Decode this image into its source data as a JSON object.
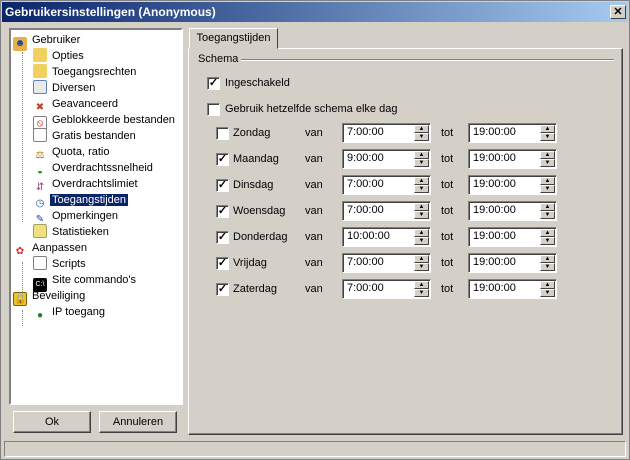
{
  "window": {
    "title": "Gebruikersinstellingen (Anonymous)"
  },
  "tree": {
    "items": [
      {
        "label": "Gebruiker",
        "icon": "user-icon",
        "selected": false
      },
      {
        "label": "Opties",
        "icon": "folder-options-icon",
        "selected": false
      },
      {
        "label": "Toegangsrechten",
        "icon": "folder-permissions-icon",
        "selected": false
      },
      {
        "label": "Diversen",
        "icon": "document-icon",
        "selected": false
      },
      {
        "label": "Geavanceerd",
        "icon": "tools-icon",
        "selected": false
      },
      {
        "label": "Geblokkeerde bestanden",
        "icon": "blocked-file-icon",
        "selected": false
      },
      {
        "label": "Gratis bestanden",
        "icon": "file-icon",
        "selected": false
      },
      {
        "label": "Quota, ratio",
        "icon": "quota-icon",
        "selected": false
      },
      {
        "label": "Overdrachtssnelheid",
        "icon": "gauge-icon",
        "selected": false
      },
      {
        "label": "Overdrachtslimiet",
        "icon": "limit-icon",
        "selected": false
      },
      {
        "label": "Toegangstijden",
        "icon": "clock-icon",
        "selected": true
      },
      {
        "label": "Opmerkingen",
        "icon": "notes-icon",
        "selected": false
      },
      {
        "label": "Statistieken",
        "icon": "stats-icon",
        "selected": false
      },
      {
        "label": "Aanpassen",
        "icon": "customize-icon",
        "selected": false
      },
      {
        "label": "Scripts",
        "icon": "script-icon",
        "selected": false
      },
      {
        "label": "Site commando's",
        "icon": "console-icon",
        "selected": false
      },
      {
        "label": "Beveiliging",
        "icon": "security-icon",
        "selected": false
      },
      {
        "label": "IP toegang",
        "icon": "ip-access-icon",
        "selected": false
      }
    ]
  },
  "buttons": {
    "ok": "Ok",
    "cancel": "Annuleren"
  },
  "tab": {
    "label": "Toegangstijden"
  },
  "schema": {
    "group_label": "Schema",
    "enabled_label": "Ingeschakeld",
    "enabled": true,
    "same_schedule_label": "Gebruik hetzelfde schema elke dag",
    "same_schedule": false,
    "from_label": "van",
    "to_label": "tot",
    "days": [
      {
        "name": "Zondag",
        "checked": false,
        "from": "7:00:00",
        "to": "19:00:00"
      },
      {
        "name": "Maandag",
        "checked": true,
        "from": "9:00:00",
        "to": "19:00:00"
      },
      {
        "name": "Dinsdag",
        "checked": true,
        "from": "7:00:00",
        "to": "19:00:00"
      },
      {
        "name": "Woensdag",
        "checked": true,
        "from": "7:00:00",
        "to": "19:00:00"
      },
      {
        "name": "Donderdag",
        "checked": true,
        "from": "10:00:00",
        "to": "19:00:00"
      },
      {
        "name": "Vrijdag",
        "checked": true,
        "from": "7:00:00",
        "to": "19:00:00"
      },
      {
        "name": "Zaterdag",
        "checked": true,
        "from": "7:00:00",
        "to": "19:00:00"
      }
    ]
  }
}
